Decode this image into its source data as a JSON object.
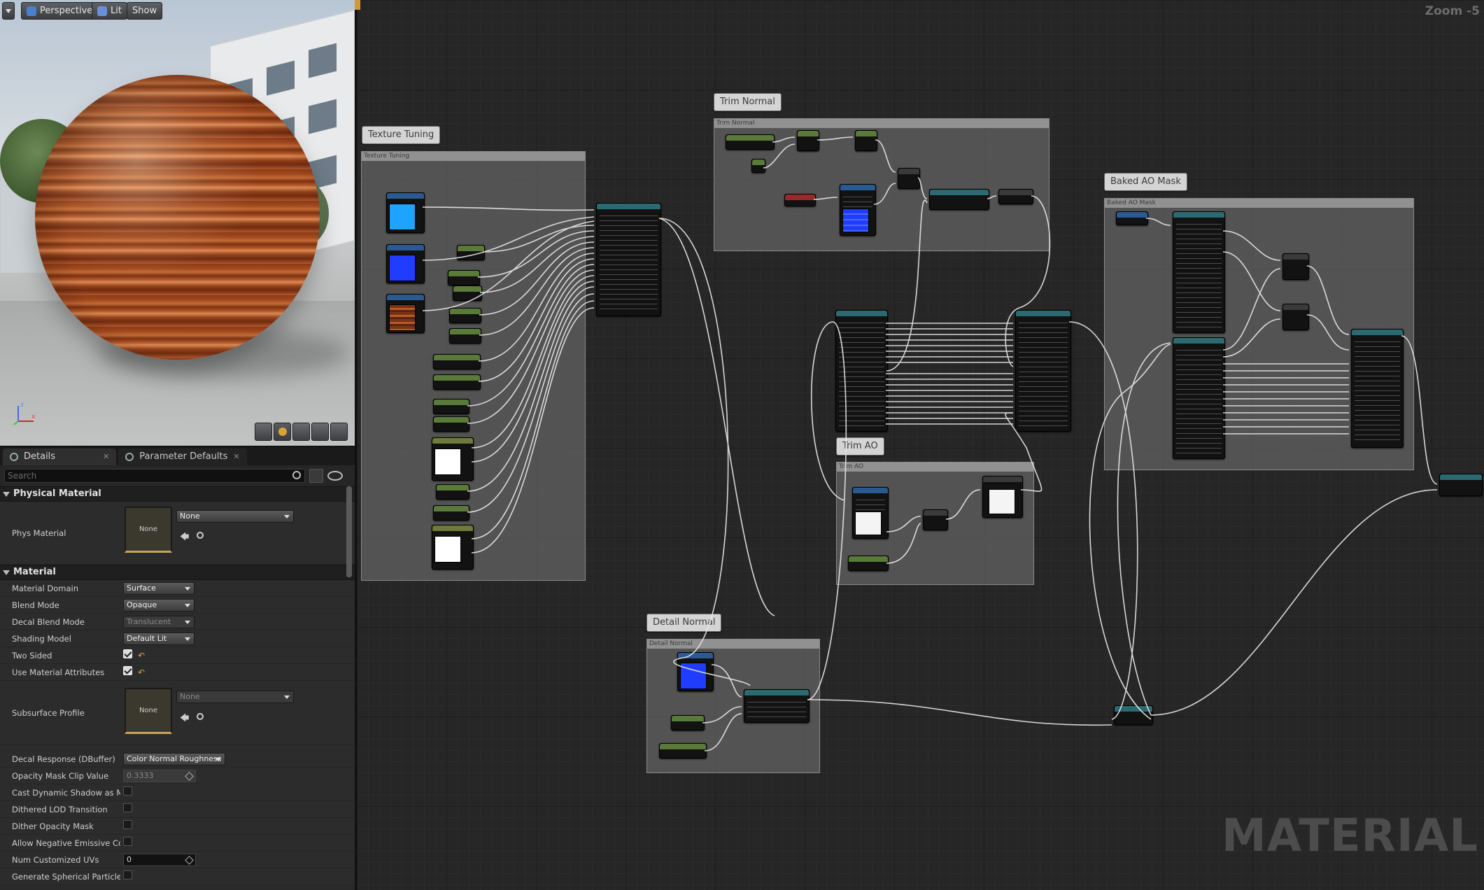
{
  "viewport": {
    "perspective_label": "Perspective",
    "lit_label": "Lit",
    "show_label": "Show",
    "bottom_buttons": [
      "camera-view-icon",
      "sphere-preview-icon",
      "plane-preview-icon",
      "cube-preview-icon",
      "mesh-preview-icon"
    ]
  },
  "details": {
    "tabs": [
      {
        "label": "Details",
        "active": true
      },
      {
        "label": "Parameter Defaults",
        "active": false
      }
    ],
    "search_placeholder": "Search",
    "physical_material": {
      "category": "Physical Material",
      "phys_material_label": "Phys Material",
      "thumb_text": "None",
      "value": "None"
    },
    "material": {
      "category": "Material",
      "rows": [
        {
          "label": "Material Domain",
          "value": "Surface",
          "kind": "dropdown"
        },
        {
          "label": "Blend Mode",
          "value": "Opaque",
          "kind": "dropdown"
        },
        {
          "label": "Decal Blend Mode",
          "value": "Translucent",
          "kind": "dropdown-disabled"
        },
        {
          "label": "Shading Model",
          "value": "Default Lit",
          "kind": "dropdown"
        },
        {
          "label": "Two Sided",
          "value": "",
          "kind": "check-on"
        },
        {
          "label": "Use Material Attributes",
          "value": "",
          "kind": "check-on"
        }
      ],
      "subsurface_profile": {
        "label": "Subsurface Profile",
        "thumb_text": "None",
        "value": "None"
      },
      "rows2": [
        {
          "label": "Decal Response (DBuffer)",
          "value": "Color Normal Roughness",
          "kind": "dropdown-wide"
        },
        {
          "label": "Opacity Mask Clip Value",
          "value": "0.3333",
          "kind": "number-disabled"
        },
        {
          "label": "Cast Dynamic Shadow as Masked",
          "value": "",
          "kind": "check-off"
        },
        {
          "label": "Dithered LOD Transition",
          "value": "",
          "kind": "check-off"
        },
        {
          "label": "Dither Opacity Mask",
          "value": "",
          "kind": "check-off"
        },
        {
          "label": "Allow Negative Emissive Color",
          "value": "",
          "kind": "check-off"
        },
        {
          "label": "Num Customized UVs",
          "value": "0",
          "kind": "number"
        },
        {
          "label": "Generate Spherical Particle Normals",
          "value": "",
          "kind": "check-off"
        }
      ]
    }
  },
  "graph": {
    "zoom_label": "Zoom -5",
    "watermark": "MATERIAL",
    "comments": [
      {
        "tag": "Texture Tuning",
        "header": "Texture Tuning"
      },
      {
        "tag": "Trim Normal",
        "header": "Trim Normal"
      },
      {
        "tag": "Baked AO Mask",
        "header": "Baked AO Mask"
      },
      {
        "tag": "Trim AO",
        "header": "Trim AO"
      },
      {
        "tag": "Detail Normal",
        "header": "Detail Normal"
      }
    ]
  },
  "colors": {
    "accent_orange": "#d49b2c",
    "texture_blue": "#1f3cff",
    "texture_cyan": "#1ea3ff",
    "wood": "#8a3b16"
  }
}
